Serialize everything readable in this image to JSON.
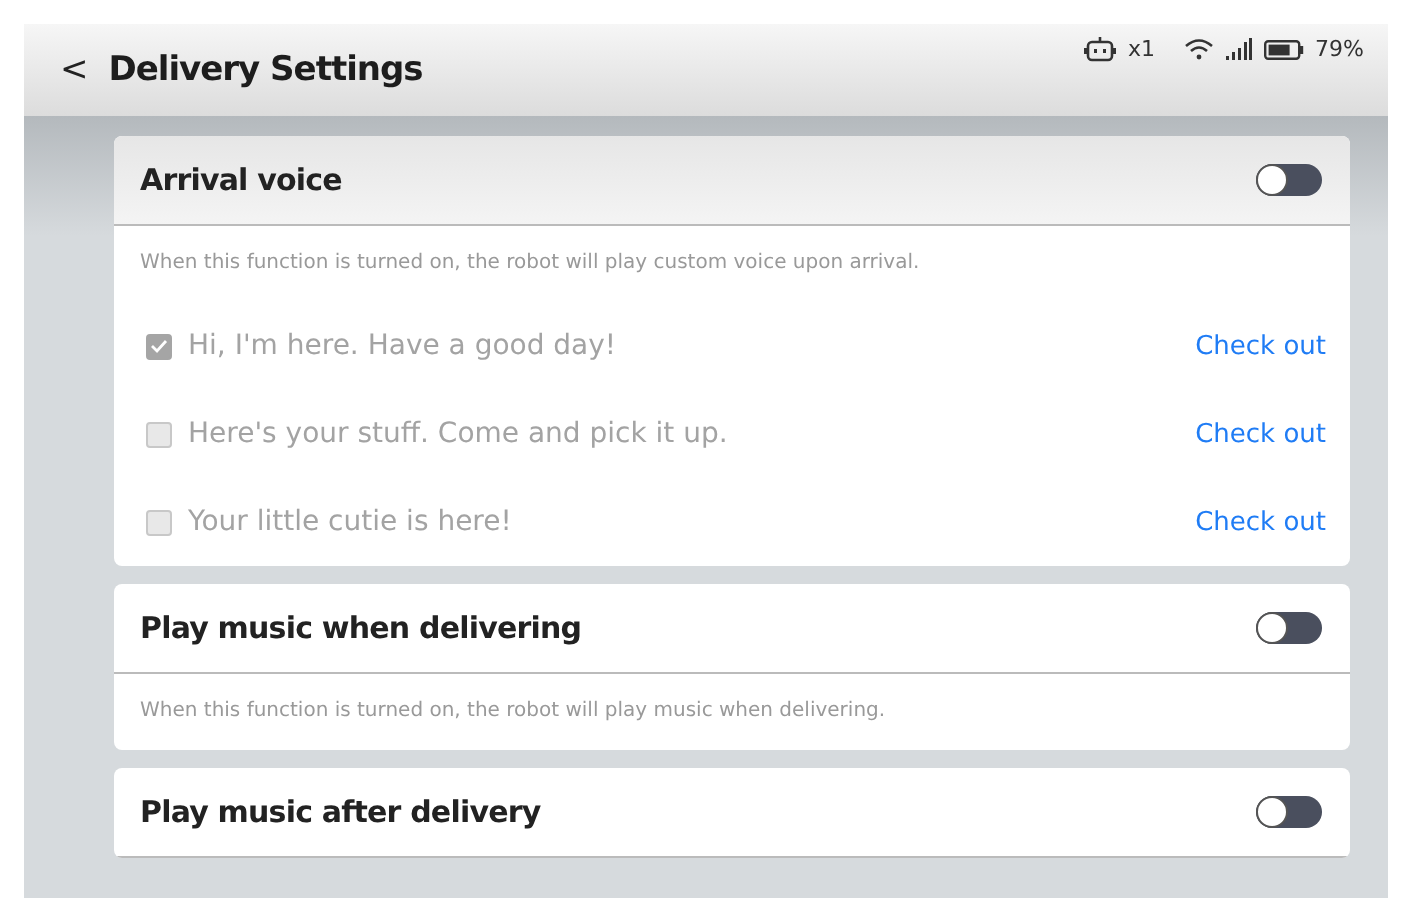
{
  "header": {
    "back": "<",
    "title": "Delivery Settings"
  },
  "status_bar": {
    "robot_count": "x1",
    "battery": "79%"
  },
  "sections": [
    {
      "title": "Arrival voice",
      "on": false,
      "description": "When this function is turned on, the robot will play custom voice upon arrival.",
      "options": [
        {
          "label": "Hi, I'm here. Have a good day!",
          "checked": true,
          "link": "Check out"
        },
        {
          "label": "Here's your stuff. Come and pick it up.",
          "checked": false,
          "link": "Check out"
        },
        {
          "label": "Your little cutie is here!",
          "checked": false,
          "link": "Check out"
        }
      ]
    },
    {
      "title": "Play music when delivering",
      "on": false,
      "description": "When this function is turned on, the robot will play music when delivering."
    },
    {
      "title": "Play music after delivery",
      "on": false
    }
  ]
}
